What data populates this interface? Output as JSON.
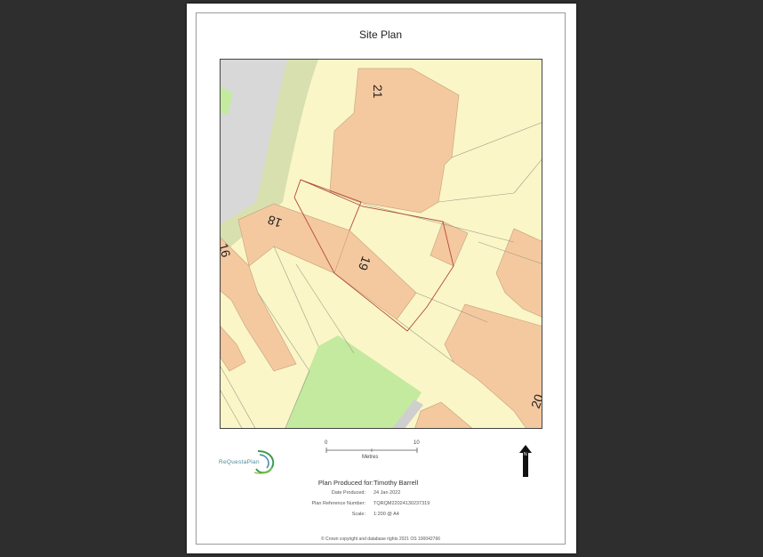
{
  "page": {
    "title": "Site Plan"
  },
  "map": {
    "house_numbers": [
      "21",
      "18",
      "19",
      "16",
      "20"
    ],
    "colors": {
      "ground": "#fbf6c7",
      "building": "#f5c9a0",
      "road": "#d9d9d9",
      "verge": "#d8e0b0",
      "green": "#c4eaa0",
      "boundary": "#b04a3a"
    }
  },
  "scale_bar": {
    "start": "0",
    "end": "10",
    "unit": "Metres"
  },
  "logo": {
    "text": "ReQuestaPlan"
  },
  "north_arrow": {
    "label": "N",
    "icon": "north-arrow-icon"
  },
  "info": {
    "produced_for_label": "Plan Produced for:",
    "produced_for_value": "Timothy Barrell",
    "rows": [
      {
        "key": "Date Produced:",
        "value": "24 Jan 2022"
      },
      {
        "key": "Plan Reference Number:",
        "value": "TQRQM22024130237319"
      },
      {
        "key": "Scale:",
        "value": "1:200 @ A4"
      }
    ]
  },
  "copyright": "© Crown copyright and database rights 2021 OS 100042766"
}
